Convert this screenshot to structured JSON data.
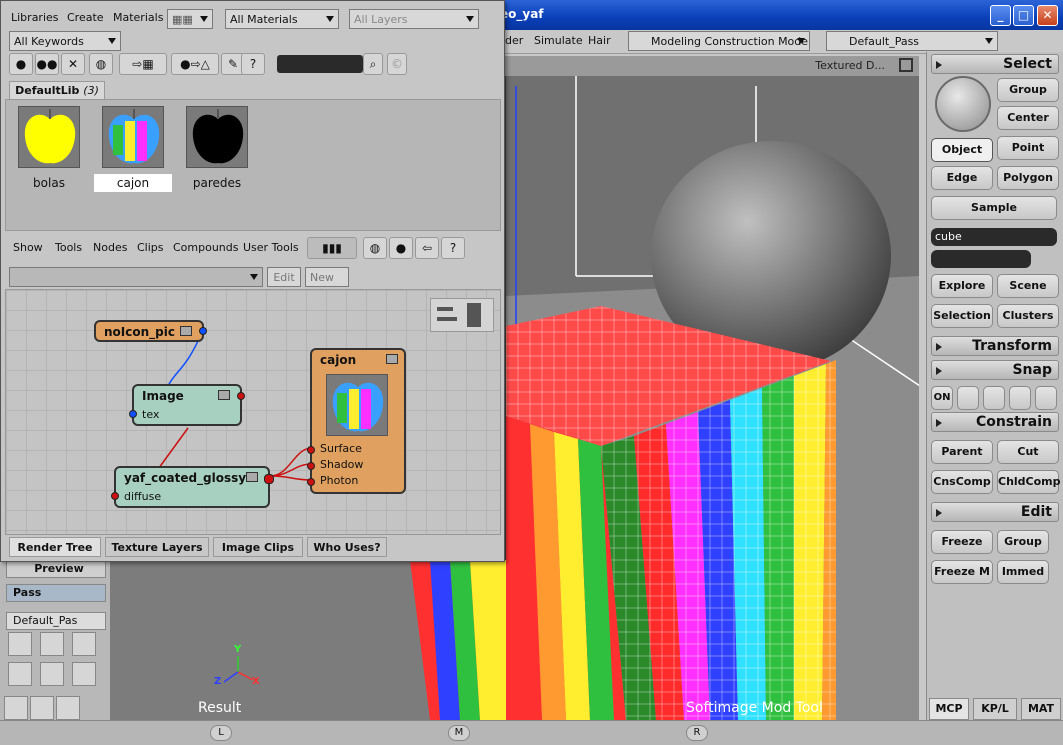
{
  "window": {
    "title": "eo_yaf",
    "minimize": "_",
    "maximize": "□",
    "close": "✕"
  },
  "mainbar": {
    "menus": [
      "der",
      "Simulate",
      "Hair"
    ],
    "mode": "Modeling Construction Mode",
    "pass": "Default_Pass"
  },
  "viewport": {
    "view_label": "Textured D...",
    "bottom_left_label": "Result",
    "bottom_right_label": "Softimage  Mod  Tool",
    "axis_y": "Y",
    "axis_z": "Z",
    "axis_x": "X"
  },
  "left_strip": {
    "preview": "Preview",
    "pass_label": "Pass",
    "pass_value": "Default_Pas"
  },
  "bottombar": {
    "left": "L",
    "middle": "M",
    "right": "R"
  },
  "mcp": {
    "select": {
      "header": "Select",
      "group": "Group",
      "center": "Center",
      "object": "Object",
      "point": "Point",
      "edge": "Edge",
      "polygon": "Polygon",
      "sample": "Sample",
      "name_field": "cube",
      "explore": "Explore",
      "scene": "Scene",
      "selection": "Selection",
      "clusters": "Clusters"
    },
    "transform": {
      "header": "Transform"
    },
    "snap": {
      "header": "Snap",
      "on": "ON"
    },
    "constrain": {
      "header": "Constrain",
      "parent": "Parent",
      "cut": "Cut",
      "cnscomp": "CnsComp",
      "chldcomp": "ChldComp"
    },
    "edit": {
      "header": "Edit",
      "freeze": "Freeze",
      "group": "Group",
      "freeze_m": "Freeze M",
      "immed": "Immed"
    },
    "tabs": [
      "MCP",
      "KP/L",
      "MAT"
    ]
  },
  "render_tree": {
    "menu": [
      "Libraries",
      "Create",
      "Materials"
    ],
    "materials_combo": "All Materials",
    "layers_combo": "All Layers",
    "keywords_combo": "All Keywords",
    "lib_tab": "DefaultLib",
    "lib_count": "(3)",
    "materials": [
      {
        "name": "bolas",
        "color": "#ffff00"
      },
      {
        "name": "cajon",
        "color": "#3aa0ff"
      },
      {
        "name": "paredes",
        "color": "#000000"
      }
    ],
    "menu2": [
      "Show",
      "Tools",
      "Nodes",
      "Clips",
      "Compounds",
      "User Tools"
    ],
    "edit_btn": "Edit",
    "new_btn": "New",
    "nodes": {
      "noicon": {
        "title": "noIcon_pic",
        "color": "#e0a060"
      },
      "image": {
        "title": "Image",
        "port": "tex",
        "color": "#a8d0c0"
      },
      "glossy": {
        "title": "yaf_coated_glossy",
        "port": "diffuse",
        "color": "#a8d0c0"
      },
      "cajon": {
        "title": "cajon",
        "ports": [
          "Surface",
          "Shadow",
          "Photon"
        ],
        "color": "#e0a060"
      }
    },
    "tabs": [
      "Render Tree",
      "Texture Layers",
      "Image Clips",
      "Who Uses?"
    ]
  }
}
